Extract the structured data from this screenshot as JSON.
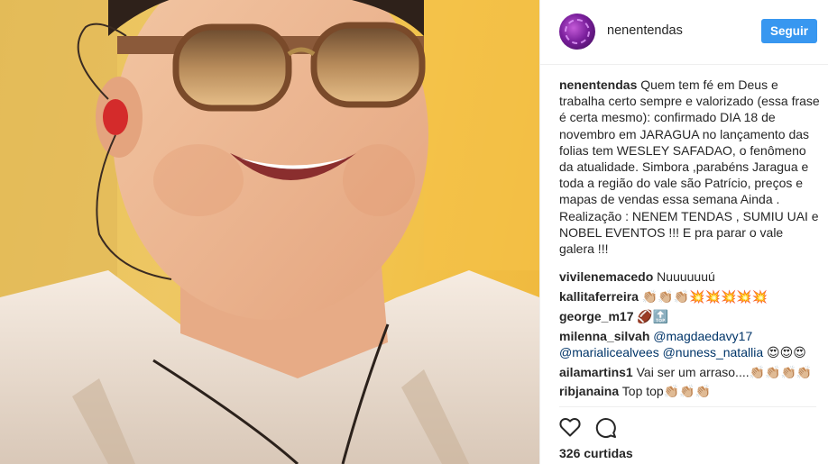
{
  "post": {
    "author": "nenentendas",
    "follow_label": "Seguir",
    "caption_user": "nenentendas",
    "caption_text": "Quem tem fé em Deus e trabalha certo sempre e valorizado (essa frase é certa mesmo): confirmado DIA 18 de novembro em JARAGUA no lançamento das folias tem WESLEY SAFADAO, o fenômeno da atualidade. Simbora ,parabéns Jaragua e toda a região do vale são Patrício, preços e mapas de vendas essa semana Ainda . Realização : NENEM TENDAS , SUMIU UAI e NOBEL EVENTOS !!! E pra parar o vale galera !!!",
    "likes_text": "326 curtidas"
  },
  "comments": [
    {
      "user": "vivilenemacedo",
      "text": "Nuuuuuuú"
    },
    {
      "user": "kallitaferreira",
      "text": "👏🏼👏🏼👏🏼💥💥💥💥💥"
    },
    {
      "user": "george_m17",
      "text": "🏈🔝"
    },
    {
      "user": "milenna_silvah",
      "mention1": "@magdaedavy17",
      "mention2": "@marialicealvees",
      "mention3": "@nuness_natallia",
      "text": "😍😍😍"
    },
    {
      "user": "ailamartins1",
      "text": "Vai ser um arraso....👏🏼👏🏼👏🏼👏🏼"
    },
    {
      "user": "ribjanaina",
      "text": "Top top👏🏼👏🏼👏🏼"
    }
  ],
  "icons": {
    "like": "heart-outline-icon",
    "comment": "comment-bubble-icon"
  },
  "colors": {
    "follow_button": "#3897f0",
    "mention": "#003569",
    "background_photo": "#f2c34c"
  }
}
